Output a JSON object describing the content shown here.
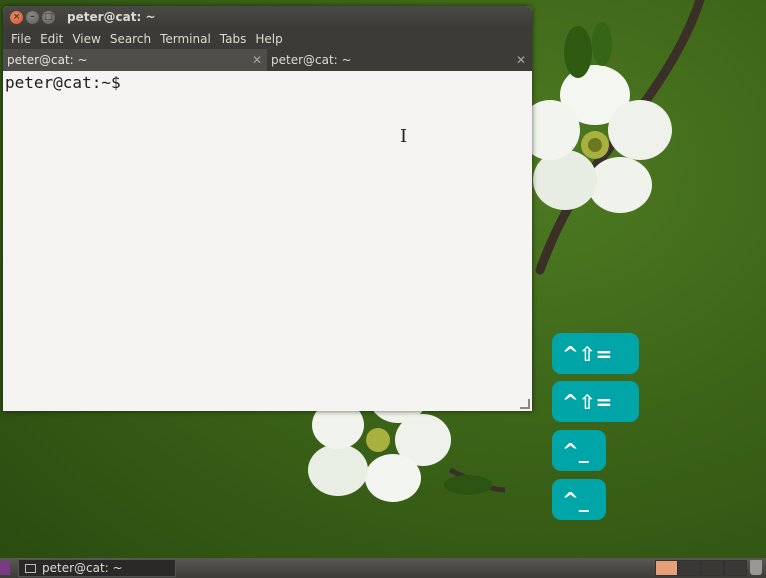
{
  "window": {
    "title": "peter@cat: ~",
    "buttons": {
      "close": "×",
      "minimize": "–",
      "maximize": "□"
    }
  },
  "menubar": [
    "File",
    "Edit",
    "View",
    "Search",
    "Terminal",
    "Tabs",
    "Help"
  ],
  "tabs": [
    {
      "label": "peter@cat: ~",
      "close": "✕"
    },
    {
      "label": "peter@cat: ~",
      "close": "✕"
    }
  ],
  "terminal": {
    "prompt": "peter@cat:~$"
  },
  "keys": [
    {
      "label": "^⇧="
    },
    {
      "label": "^⇧="
    },
    {
      "label": "^_"
    },
    {
      "label": "^_"
    }
  ],
  "taskbar": {
    "item_label": "peter@cat: ~"
  },
  "colors": {
    "key_bg": "#00a5a8",
    "active_workspace": "#e8a07a"
  }
}
